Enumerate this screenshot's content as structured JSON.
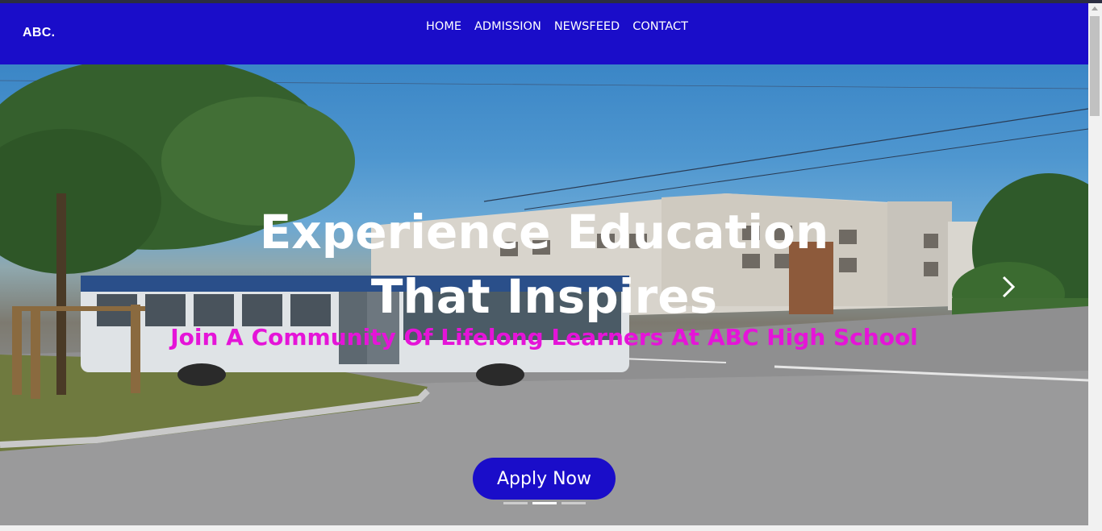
{
  "navbar": {
    "brand": "ABC.",
    "links": [
      "HOME",
      "ADMISSION",
      "NEWSFEED",
      "CONTACT"
    ]
  },
  "hero": {
    "headline": "Experience Education That Inspires",
    "subheadline": "Join A Community Of Lifelong Learners At ABC High School",
    "cta_label": "Apply Now",
    "carousel": {
      "slides": 3,
      "active_slide": 2
    },
    "next_icon": "chevron-right-icon"
  },
  "colors": {
    "navbar_bg": "#1a0dc9",
    "button_bg": "#1a0dc9",
    "subheadline": "#e514d8",
    "headline": "#ffffff"
  }
}
